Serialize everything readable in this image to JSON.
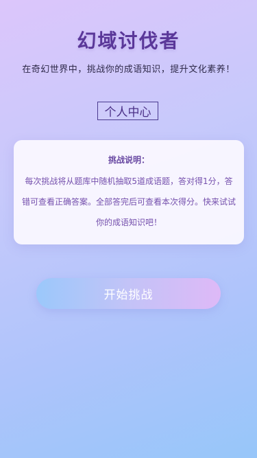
{
  "header": {
    "title": "幻域讨伐者",
    "subtitle": "在奇幻世界中，挑战你的成语知识，提升文化素养！"
  },
  "profile_button": {
    "label": "个人中心"
  },
  "rules_card": {
    "title": "挑战说明：",
    "body": "每次挑战将从题库中随机抽取5道成语题，答对得1分，答错可查看正确答案。全部答完后可查看本次得分。快来试试你的成语知识吧！"
  },
  "start_button": {
    "label": "开始挑战"
  },
  "colors": {
    "title": "#5a3799",
    "card_text": "#7550ad",
    "gradient_top": "#dcc6fb",
    "gradient_bottom": "#97c6f9"
  }
}
